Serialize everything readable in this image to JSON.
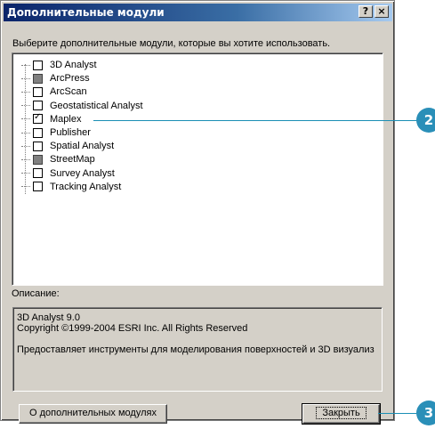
{
  "window": {
    "title": "Дополнительные модули",
    "help_label": "?",
    "close_label": "×"
  },
  "instruction": "Выберите дополнительные модули, которые вы хотите использовать.",
  "extensions": [
    {
      "label": "3D Analyst",
      "state": "unchecked"
    },
    {
      "label": "ArcPress",
      "state": "unavailable"
    },
    {
      "label": "ArcScan",
      "state": "unchecked"
    },
    {
      "label": "Geostatistical Analyst",
      "state": "unchecked"
    },
    {
      "label": "Maplex",
      "state": "checked"
    },
    {
      "label": "Publisher",
      "state": "unchecked"
    },
    {
      "label": "Spatial Analyst",
      "state": "unchecked"
    },
    {
      "label": "StreetMap",
      "state": "unavailable"
    },
    {
      "label": "Survey Analyst",
      "state": "unchecked"
    },
    {
      "label": "Tracking Analyst",
      "state": "unchecked"
    }
  ],
  "description": {
    "label": "Описание:",
    "line1": "3D Analyst 9.0",
    "line2": "Copyright ©1999-2004 ESRI Inc. All Rights Reserved",
    "line3": "Предоставляет инструменты для моделирования поверхностей и 3D визуализ"
  },
  "buttons": {
    "about": "О дополнительных модулях",
    "close": "Закрыть"
  },
  "callouts": {
    "first": "2",
    "second": "3"
  },
  "colors": {
    "title_bar": "#0a246a",
    "callout": "#2a8fb8"
  }
}
